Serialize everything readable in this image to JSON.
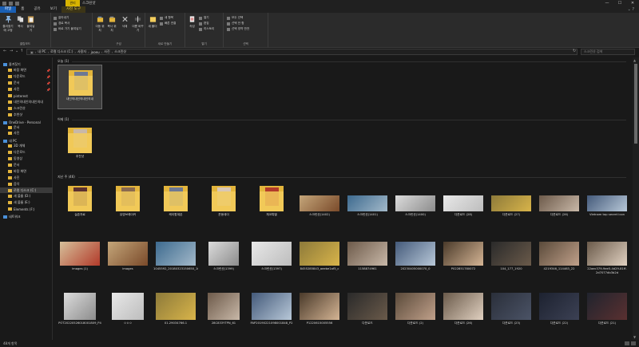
{
  "window": {
    "title": "스크린샷",
    "context_tab": "관리",
    "minimize": "—",
    "maximize": "☐",
    "close": "✕"
  },
  "tabs": [
    {
      "label": "파일"
    },
    {
      "label": "홈"
    },
    {
      "label": "공유"
    },
    {
      "label": "보기"
    },
    {
      "label": "사진 도구"
    }
  ],
  "ribbon": {
    "pin_label": "즐겨찾기에 고정",
    "copy_label": "복사",
    "paste_label": "붙여넣기",
    "cut_label": "잘라내기",
    "copy_path_label": "경로 복사",
    "paste_shortcut_label": "바로 가기 붙여넣기",
    "clipboard_group": "클립보드",
    "move_to_label": "이동 위치",
    "copy_to_label": "복사 위치",
    "delete_label": "삭제",
    "rename_label": "이름 바꾸기",
    "organize_group": "구성",
    "new_folder_label": "새 폴더",
    "new_item_label": "새 항목",
    "easy_access_label": "빠른 연결",
    "new_group": "새로 만들기",
    "properties_label": "속성",
    "open_label": "열기",
    "edit_label": "편집",
    "history_label": "히스토리",
    "open_group": "열기",
    "select_all_label": "모두 선택",
    "select_none_label": "선택 안 함",
    "invert_selection_label": "선택 영역 반전",
    "select_group": "선택"
  },
  "address": {
    "crumbs": [
      "내 PC",
      "로컬 디스크 (C:)",
      "사용자",
      "jooeu",
      "사진",
      "스크린샷"
    ],
    "search_placeholder": "스크린샷 검색"
  },
  "sidebar": [
    {
      "label": "즐겨찾기",
      "type": "header",
      "pin": ""
    },
    {
      "label": "바탕 화면",
      "type": "item",
      "pin": "📌"
    },
    {
      "label": "다운로드",
      "type": "item",
      "pin": "📌"
    },
    {
      "label": "문서",
      "type": "item",
      "pin": "📌"
    },
    {
      "label": "사진",
      "type": "item",
      "pin": "📌"
    },
    {
      "label": "pinterest",
      "type": "item",
      "pin": ""
    },
    {
      "label": "내인의내인의내인의내",
      "type": "item",
      "pin": ""
    },
    {
      "label": "스크린샷",
      "type": "item",
      "pin": ""
    },
    {
      "label": "추천샷",
      "type": "item",
      "pin": ""
    },
    {
      "label": "OneDrive - Personal",
      "type": "header",
      "pin": ""
    },
    {
      "label": "문서",
      "type": "item",
      "pin": ""
    },
    {
      "label": "사진",
      "type": "item",
      "pin": ""
    },
    {
      "label": "내 PC",
      "type": "header",
      "pin": ""
    },
    {
      "label": "3D 개체",
      "type": "item",
      "pin": ""
    },
    {
      "label": "다운로드",
      "type": "item",
      "pin": ""
    },
    {
      "label": "동영상",
      "type": "item",
      "pin": ""
    },
    {
      "label": "문서",
      "type": "item",
      "pin": ""
    },
    {
      "label": "바탕 화면",
      "type": "item",
      "pin": ""
    },
    {
      "label": "사진",
      "type": "item",
      "pin": ""
    },
    {
      "label": "음악",
      "type": "item",
      "pin": ""
    },
    {
      "label": "로컬 디스크 (C:)",
      "type": "item",
      "pin": ""
    },
    {
      "label": "새 볼륨 (D:)",
      "type": "item",
      "pin": ""
    },
    {
      "label": "새 볼륨 (E:)",
      "type": "item",
      "pin": ""
    },
    {
      "label": "Elements (F:)",
      "type": "item",
      "pin": ""
    },
    {
      "label": "네트워크",
      "type": "header",
      "pin": ""
    }
  ],
  "groups": [
    {
      "header": "오늘 (1)"
    },
    {
      "header": "어제 (1)"
    },
    {
      "header": "지난 주 (46)"
    }
  ],
  "today_items": [
    {
      "label": "내인의내인의내인의내"
    }
  ],
  "yesterday_items": [
    {
      "label": "추천샷"
    }
  ],
  "lastweek_row1": [
    {
      "label": "실존자료"
    },
    {
      "label": "유영브레이커"
    },
    {
      "label": "케이팝데몬"
    },
    {
      "label": "운동데이"
    },
    {
      "label": "체코특별"
    },
    {
      "label": "스크린샷(1402)"
    },
    {
      "label": "스크린샷(1401)"
    },
    {
      "label": "스크린샷(1400)"
    },
    {
      "label": "다운로드 (28)"
    },
    {
      "label": "다운로드 (27)"
    },
    {
      "label": "다운로드 (26)"
    },
    {
      "label": "Vietnam top secret icon"
    }
  ],
  "lastweek_row2": [
    {
      "label": "images (1)"
    },
    {
      "label": "images"
    },
    {
      "label": "1045592_20180323150650_100_0001"
    },
    {
      "label": "스크린샷(1399)"
    },
    {
      "label": "스크린샷(1397)"
    },
    {
      "label": "8455285843_aeebe1af5_c"
    },
    {
      "label": "1158874961"
    },
    {
      "label": "20230405000070_0"
    },
    {
      "label": "P022851780072"
    },
    {
      "label": "104_177_1920"
    },
    {
      "label": "4219346_114463_22"
    },
    {
      "label": "22aec379-9ee5-4d29-81ff-2d7077db3b2d"
    }
  ],
  "lastweek_row3": [
    {
      "label": "POT20220526018001809_P4"
    },
    {
      "label": "ㅇㅇㅇ"
    },
    {
      "label": "01.29034766.1"
    },
    {
      "label": "28C833YTPN_61"
    },
    {
      "label": "PAP20190221098001848_P2"
    },
    {
      "label": "P1220615005556"
    },
    {
      "label": "다운로드"
    },
    {
      "label": "다운로드 (2)"
    },
    {
      "label": "다운로드 (26)"
    },
    {
      "label": "다운로드 (23)"
    },
    {
      "label": "다운로드 (22)"
    },
    {
      "label": "다운로드 (21)"
    }
  ],
  "status": {
    "count_text": "48개 항목"
  },
  "colors": {
    "accent": "#1a5fb4",
    "folder": "#f3cd5d",
    "background": "#191919"
  }
}
